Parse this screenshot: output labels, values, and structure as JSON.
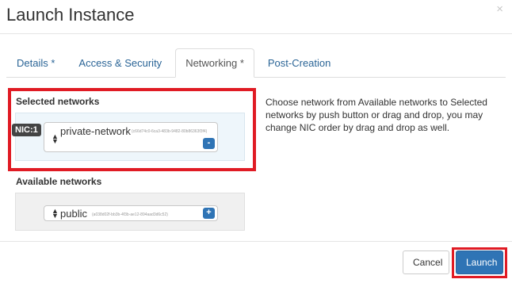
{
  "dialog": {
    "title": "Launch Instance",
    "close_label": "×"
  },
  "tabs": [
    {
      "label": "Details *",
      "active": false
    },
    {
      "label": "Access & Security",
      "active": false
    },
    {
      "label": "Networking *",
      "active": true
    },
    {
      "label": "Post-Creation",
      "active": false
    }
  ],
  "networking": {
    "selected_label": "Selected networks",
    "available_label": "Available networks",
    "selected": [
      {
        "nic": "NIC:1",
        "name": "private-network",
        "id": "(c66d74c0-6ca3-483b-9482-80b86363f3f4)",
        "action": "-"
      }
    ],
    "available": [
      {
        "name": "public",
        "id": "(a038d02f-bb3b-4f3b-ae12-894aad3d6c52)",
        "action": "+"
      }
    ],
    "help_text": "Choose network from Available networks to Selected networks by push button or drag and drop, you may change NIC order by drag and drop as well."
  },
  "footer": {
    "cancel_label": "Cancel",
    "launch_label": "Launch"
  },
  "colors": {
    "accent": "#2f74b5",
    "highlight": "#e01b24"
  }
}
